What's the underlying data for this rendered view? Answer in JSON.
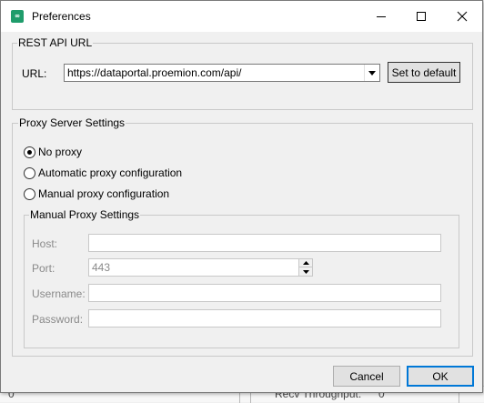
{
  "window": {
    "title": "Preferences",
    "app_icon": "proemion-app-icon"
  },
  "rest_api": {
    "group_title": "REST API URL",
    "url_label": "URL:",
    "url_value": "https://dataportal.proemion.com/api/",
    "set_default_label": "Set to default"
  },
  "proxy": {
    "group_title": "Proxy Server Settings",
    "options": [
      {
        "label": "No proxy",
        "checked": true
      },
      {
        "label": "Automatic proxy configuration",
        "checked": false
      },
      {
        "label": "Manual proxy configuration",
        "checked": false
      }
    ],
    "manual": {
      "group_title": "Manual Proxy Settings",
      "host_label": "Host:",
      "host_value": "",
      "port_label": "Port:",
      "port_value": "443",
      "username_label": "Username:",
      "username_value": "",
      "password_label": "Password:",
      "password_value": ""
    }
  },
  "footer": {
    "cancel_label": "Cancel",
    "ok_label": "OK"
  },
  "background": {
    "left_value": "0",
    "throughput_label": "Recv Throughput:",
    "throughput_value": "0"
  },
  "colors": {
    "accent": "#0078d7",
    "app_icon": "#1f9c6b",
    "disabled_text": "#8a8a8a"
  }
}
